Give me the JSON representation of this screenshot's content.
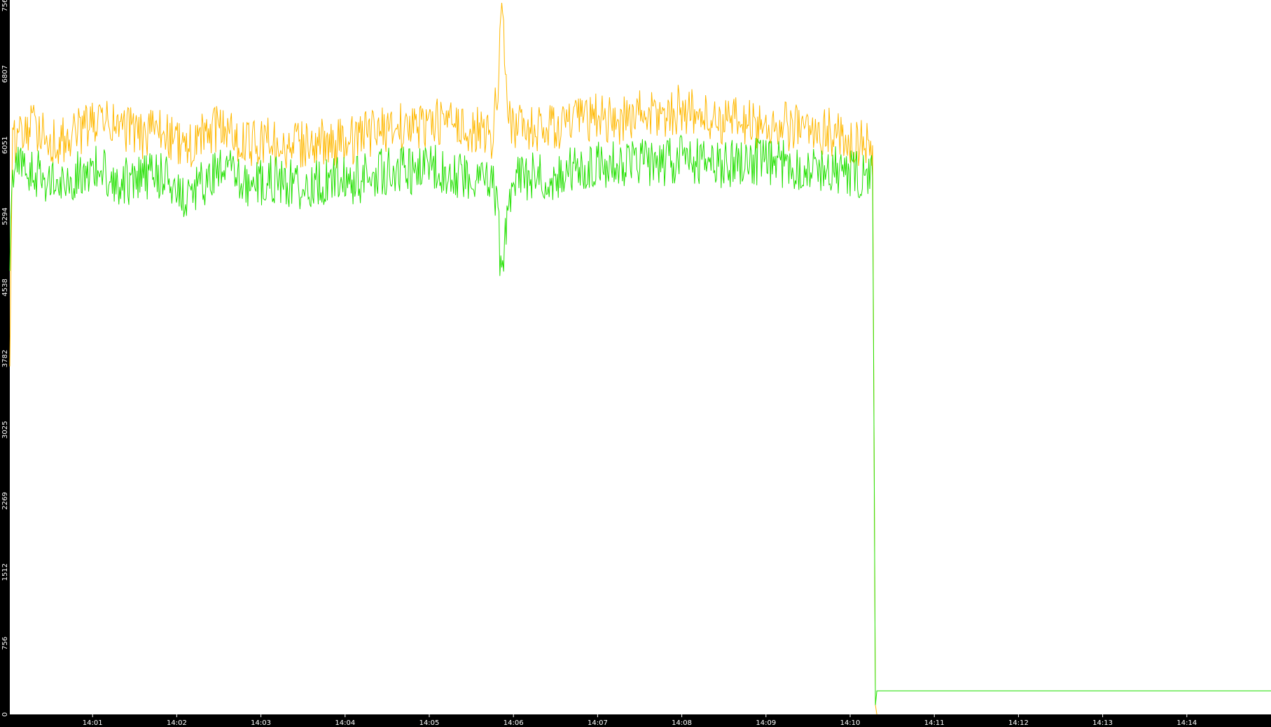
{
  "chart_data": {
    "type": "line",
    "title": "",
    "xlabel": "",
    "ylabel": "",
    "background": "#ffffff",
    "frame_color": "#000000",
    "grid": false,
    "legend": "none",
    "ylim": [
      0,
      7564
    ],
    "xlim": [
      "14:00:01",
      "14:15:00"
    ],
    "y_ticks": [
      "0",
      "756",
      "1512",
      "2269",
      "3025",
      "3782",
      "4538",
      "5294",
      "6051",
      "6807",
      "7564"
    ],
    "x_ticks": [
      "14:01",
      "14:02",
      "14:03",
      "14:04",
      "14:05",
      "14:06",
      "14:07",
      "14:08",
      "14:09",
      "14:10",
      "14:11",
      "14:12",
      "14:13",
      "14:14"
    ],
    "series": [
      {
        "color": "#ffb800",
        "x": [
          "14:00:01",
          "14:00:03",
          "14:00:20",
          "14:00:35",
          "14:00:50",
          "14:01:05",
          "14:01:20",
          "14:01:35",
          "14:01:50",
          "14:02:05",
          "14:02:20",
          "14:02:35",
          "14:02:50",
          "14:03:05",
          "14:03:20",
          "14:03:35",
          "14:03:50",
          "14:04:05",
          "14:04:20",
          "14:04:35",
          "14:04:50",
          "14:05:05",
          "14:05:20",
          "14:05:35",
          "14:05:45",
          "14:05:49",
          "14:05:51",
          "14:05:53",
          "14:05:56",
          "14:06:00",
          "14:06:15",
          "14:06:30",
          "14:06:45",
          "14:07:00",
          "14:07:15",
          "14:07:30",
          "14:07:45",
          "14:08:00",
          "14:08:15",
          "14:08:30",
          "14:08:45",
          "14:09:00",
          "14:09:15",
          "14:09:30",
          "14:09:45",
          "14:10:00",
          "14:10:10",
          "14:10:16",
          "14:10:17",
          "14:10:18",
          "14:10:19"
        ],
        "y": [
          3700,
          6100,
          6250,
          6050,
          6200,
          6300,
          6250,
          6150,
          6200,
          6000,
          6150,
          6250,
          6050,
          6100,
          6000,
          6100,
          6050,
          6100,
          6200,
          6250,
          6250,
          6300,
          6250,
          6200,
          6150,
          6700,
          7500,
          7300,
          6400,
          6250,
          6200,
          6250,
          6300,
          6350,
          6300,
          6400,
          6350,
          6450,
          6350,
          6300,
          6300,
          6250,
          6250,
          6200,
          6200,
          6100,
          6050,
          6050,
          3000,
          100,
          0
        ]
      },
      {
        "color": "#22e000",
        "x": [
          "14:00:01",
          "14:00:03",
          "14:00:20",
          "14:00:35",
          "14:00:50",
          "14:01:05",
          "14:01:20",
          "14:01:35",
          "14:01:50",
          "14:02:05",
          "14:02:20",
          "14:02:35",
          "14:02:50",
          "14:03:05",
          "14:03:20",
          "14:03:35",
          "14:03:50",
          "14:04:05",
          "14:04:20",
          "14:04:35",
          "14:04:50",
          "14:05:05",
          "14:05:20",
          "14:05:35",
          "14:05:45",
          "14:05:49",
          "14:05:51",
          "14:05:53",
          "14:05:56",
          "14:06:00",
          "14:06:15",
          "14:06:30",
          "14:06:45",
          "14:07:00",
          "14:07:15",
          "14:07:30",
          "14:07:45",
          "14:08:00",
          "14:08:15",
          "14:08:30",
          "14:08:45",
          "14:09:00",
          "14:09:15",
          "14:09:30",
          "14:09:45",
          "14:10:00",
          "14:10:10",
          "14:10:16",
          "14:10:17",
          "14:10:18",
          "14:10:19",
          "14:10:20",
          "14:15:00"
        ],
        "y": [
          4700,
          5800,
          5750,
          5600,
          5750,
          5800,
          5650,
          5700,
          5750,
          5500,
          5650,
          5800,
          5600,
          5700,
          5650,
          5600,
          5700,
          5650,
          5750,
          5800,
          5750,
          5800,
          5750,
          5700,
          5650,
          5300,
          4700,
          4900,
          5400,
          5650,
          5750,
          5700,
          5800,
          5850,
          5850,
          5900,
          5850,
          5900,
          5850,
          5850,
          5900,
          5850,
          5850,
          5800,
          5800,
          5750,
          5700,
          5700,
          2950,
          100,
          250,
          250,
          250
        ]
      }
    ]
  }
}
